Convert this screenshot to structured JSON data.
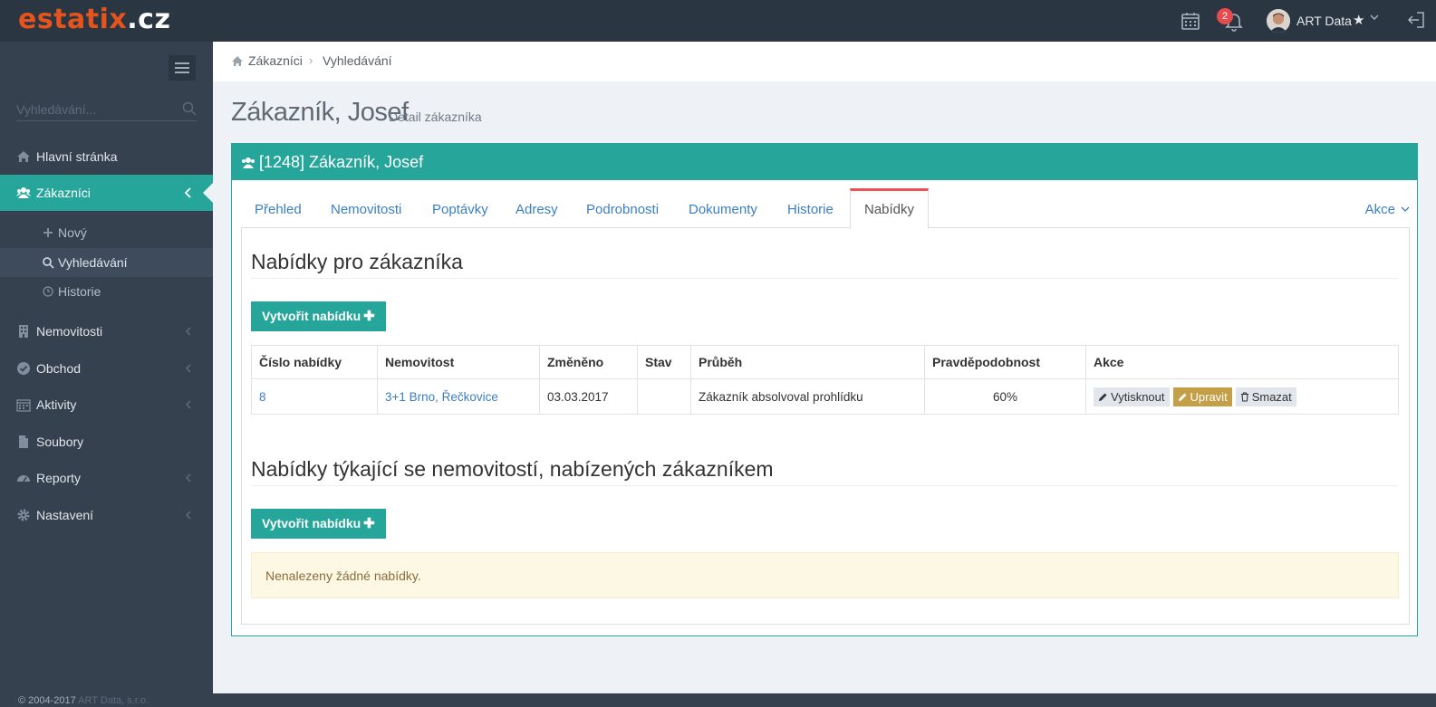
{
  "brand": {
    "name": "estatix",
    "tld": ".cz",
    "color": "#e5541c"
  },
  "topbar": {
    "notification_count": "2",
    "user_name": "ART Data",
    "icons": [
      "calendar-icon",
      "bell-icon",
      "star-icon",
      "chevron-down-icon",
      "logout-icon"
    ]
  },
  "sidebar": {
    "search_placeholder": "Vyhledávání...",
    "items": [
      {
        "label": "Hlavní stránka",
        "icon": "home-icon"
      },
      {
        "label": "Zákazníci",
        "icon": "users-icon",
        "active": true
      },
      {
        "label": "Nemovitosti",
        "icon": "building-icon"
      },
      {
        "label": "Obchod",
        "icon": "check-circle-icon"
      },
      {
        "label": "Aktivity",
        "icon": "calendar-icon"
      },
      {
        "label": "Soubory",
        "icon": "file-icon"
      },
      {
        "label": "Reporty",
        "icon": "dashboard-icon"
      },
      {
        "label": "Nastavení",
        "icon": "gear-icon"
      }
    ],
    "subitems": [
      {
        "label": "Nový",
        "icon": "plus-icon"
      },
      {
        "label": "Vyhledávání",
        "icon": "search-icon",
        "active": true
      },
      {
        "label": "Historie",
        "icon": "clock-icon"
      }
    ]
  },
  "breadcrumb": {
    "home": "Zákazníci",
    "current": "Vyhledávání"
  },
  "page": {
    "title": "Zákazník, Josef",
    "subtitle": "Detail zákazníka"
  },
  "portlet": {
    "title": "[1248] Zákazník, Josef",
    "accent": "#26a69a"
  },
  "tabs": [
    "Přehled",
    "Nemovitosti",
    "Poptávky",
    "Adresy",
    "Podrobnosti",
    "Dokumenty",
    "Historie",
    "Nabídky"
  ],
  "tabs_active": "Nabídky",
  "tabs_action": "Akce",
  "section1": {
    "title": "Nabídky pro zákazníka",
    "create_label": "Vytvořit nabídku",
    "columns": [
      "Číslo nabídky",
      "Nemovitost",
      "Změněno",
      "Stav",
      "Průběh",
      "Pravděpodobnost",
      "Akce"
    ],
    "rows": [
      {
        "number": "8",
        "property": "3+1 Brno, Řečkovice",
        "changed": "03.03.2017",
        "state": "",
        "progress": "Zákazník absolvoval prohlídku",
        "probability": "60%"
      }
    ],
    "actions": {
      "print": "Vytisknout",
      "edit": "Upravit",
      "delete": "Smazat"
    }
  },
  "section2": {
    "title": "Nabídky týkající se nemovitostí, nabízených zákazníkem",
    "create_label": "Vytvořit nabídku",
    "empty_text": "Nenalezeny žádné nabídky."
  },
  "footer": {
    "copyright": "© 2004-2017",
    "company": "ART Data, s.r.o."
  }
}
